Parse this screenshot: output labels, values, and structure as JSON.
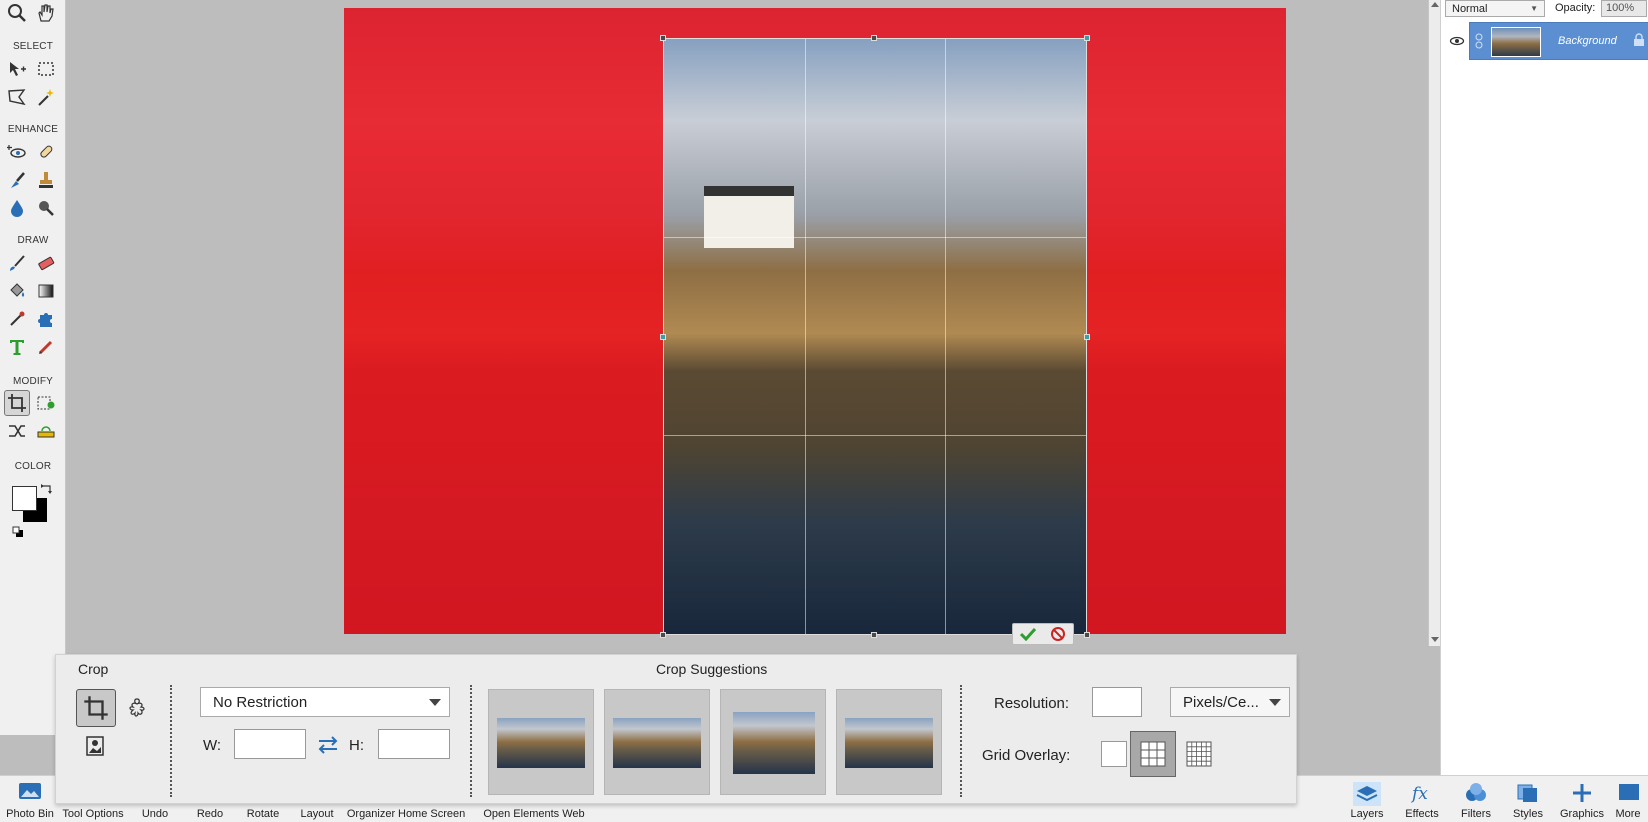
{
  "toolbox": {
    "sections": {
      "select": "SELECT",
      "enhance": "ENHANCE",
      "draw": "DRAW",
      "modify": "MODIFY",
      "color": "COLOR"
    }
  },
  "layers_panel": {
    "blend_mode": "Normal",
    "opacity_label": "Opacity:",
    "opacity_value": "100%",
    "layer_name": "Background"
  },
  "tool_options": {
    "title": "Crop",
    "suggestions_title": "Crop Suggestions",
    "preset": "No Restriction",
    "width_label": "W:",
    "height_label": "H:",
    "width_value": "",
    "height_value": "",
    "resolution_label": "Resolution:",
    "resolution_value": "",
    "units": "Pixels/Ce...",
    "grid_overlay_label": "Grid Overlay:"
  },
  "taskbar": {
    "left": [
      "Photo Bin",
      "Tool Options",
      "Undo",
      "Redo",
      "Rotate",
      "Layout",
      "Organizer",
      "Home Screen",
      "Open Elements Web"
    ],
    "right": [
      "Layers",
      "Effects",
      "Filters",
      "Styles",
      "Graphics",
      "More"
    ]
  },
  "colors": {
    "crop_mask": "#ec141e",
    "layer_selected": "#5b8fd1",
    "commit_green": "#2e9e2e",
    "cancel_red": "#cc2222"
  }
}
